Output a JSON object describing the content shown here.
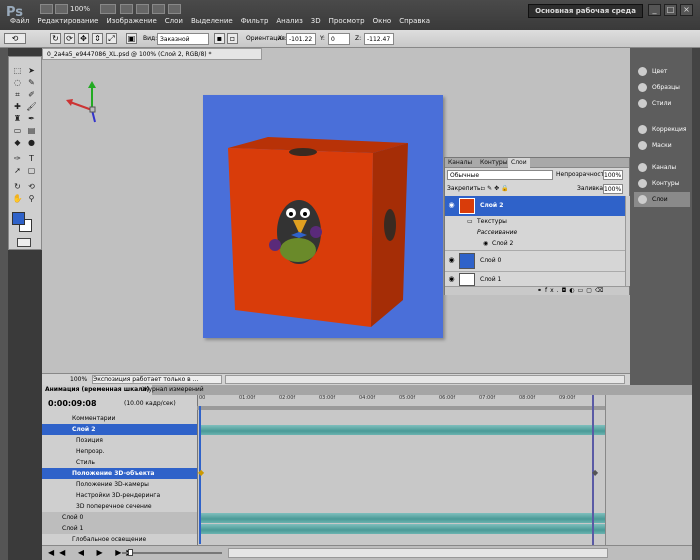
{
  "app": {
    "logo": "Ps",
    "zoom": "100%",
    "workspace": "Основная рабочая среда"
  },
  "menu": [
    "Файл",
    "Редактирование",
    "Изображение",
    "Слои",
    "Выделение",
    "Фильтр",
    "Анализ",
    "3D",
    "Просмотр",
    "Окно",
    "Справка"
  ],
  "options": {
    "view_label": "Вид:",
    "view_value": "Заказной про...",
    "orient_label": "Ориентация:",
    "x_label": "X:",
    "x_value": "-101.22",
    "y_label": "Y:",
    "y_value": "0",
    "z_label": "Z:",
    "z_value": "-112.47"
  },
  "document": {
    "tab_title": "0_2a4a5_e9447086_XL.psd @ 100% (Слой 2, RGB/8) *"
  },
  "right_dock": [
    {
      "label": "Цвет",
      "icon": "color-icon"
    },
    {
      "label": "Образцы",
      "icon": "swatches-icon"
    },
    {
      "label": "Стили",
      "icon": "styles-icon"
    },
    {
      "label": "Коррекция",
      "icon": "adjustments-icon"
    },
    {
      "label": "Маски",
      "icon": "masks-icon"
    },
    {
      "label": "Каналы",
      "icon": "channels-icon"
    },
    {
      "label": "Контуры",
      "icon": "paths-icon"
    },
    {
      "label": "Слои",
      "icon": "layers-icon"
    }
  ],
  "layers": {
    "tabs": [
      "Каналы",
      "Контуры",
      "Слои"
    ],
    "blend_mode": "Обычные",
    "opacity_label": "Непрозрачность:",
    "opacity_value": "100%",
    "lock_label": "Закрепить:",
    "fill_label": "Заливка:",
    "fill_value": "100%",
    "items": [
      {
        "name": "Слой 2",
        "selected": true
      },
      {
        "name": "Текстуры"
      },
      {
        "name": "Рассеивание"
      },
      {
        "name": "Слой 2"
      },
      {
        "name": "Слой 0"
      },
      {
        "name": "Слой 1"
      }
    ],
    "footer_fx": "fx."
  },
  "status": {
    "zoom": "100%",
    "message": "Экспозиция работает только в ..."
  },
  "animation": {
    "tabs": [
      "Анимация (временная шкала)",
      "Журнал измерений"
    ],
    "timecode": "0:00:09:08",
    "fps": "(10.00 кадр/сек)",
    "ruler": [
      "00",
      "01:00f",
      "02:00f",
      "03:00f",
      "04:00f",
      "05:00f",
      "06:00f",
      "07:00f",
      "08:00f",
      "09:00f"
    ],
    "rows": [
      "Комментарии",
      "Слой 2",
      "Позиция",
      "Непрозр.",
      "Стиль",
      "Положение 3D-объекта",
      "Положение 3D-камеры",
      "Настройки 3D-рендеринга",
      "3D поперечное сечение",
      "Слой 0",
      "Слой 1",
      "Глобальное освещение"
    ]
  },
  "colors": {
    "canvas_bg": "#4a6fd9",
    "cube_face": "#d93c0a",
    "selection": "#2f62c9"
  }
}
